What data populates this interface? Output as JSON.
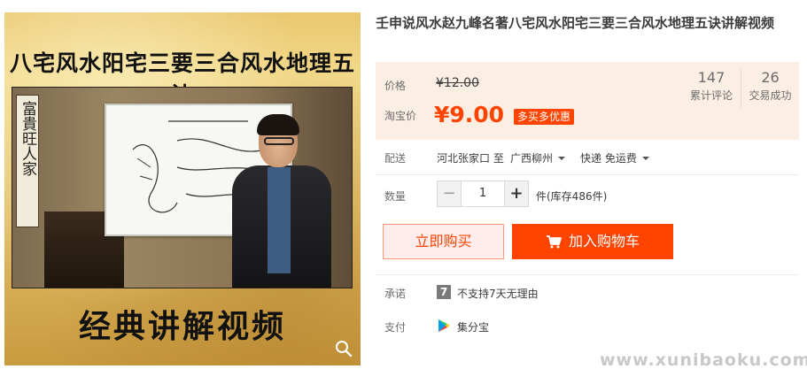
{
  "gallery": {
    "top_caption": "八宅风水阳宅三要三合风水地理五诀",
    "bottom_caption": "经典讲解视频",
    "scroll_text": "富貴旺人家",
    "zoom_icon": "magnifier-icon"
  },
  "product": {
    "title": "壬申说风水赵九峰名著八宅风水阳宅三要三合风水地理五诀讲解视频"
  },
  "price": {
    "orig_label": "价格",
    "orig_value": "¥12.00",
    "cur_label": "淘宝价",
    "cur_value": "¥9.00",
    "promo": "多买多优惠",
    "accent": "#ff4400"
  },
  "stats": [
    {
      "num": "147",
      "label": "累计评论"
    },
    {
      "num": "26",
      "label": "交易成功"
    }
  ],
  "shipping": {
    "label": "配送",
    "from": "河北张家口 至",
    "to": "广西柳州",
    "method": "快递 免运费"
  },
  "quantity": {
    "label": "数量",
    "minus": "−",
    "value": "1",
    "plus": "+",
    "stock": "件(库存486件)"
  },
  "actions": {
    "buy": "立即购买",
    "cart": "加入购物车",
    "cart_icon": "shopping-cart-icon"
  },
  "promise": {
    "label": "承诺",
    "badge": "7",
    "text": "不支持7天无理由"
  },
  "payment": {
    "label": "支付",
    "icon": "google-play-style-icon",
    "text": "集分宝"
  },
  "watermark": "www.xunibaoku.com"
}
